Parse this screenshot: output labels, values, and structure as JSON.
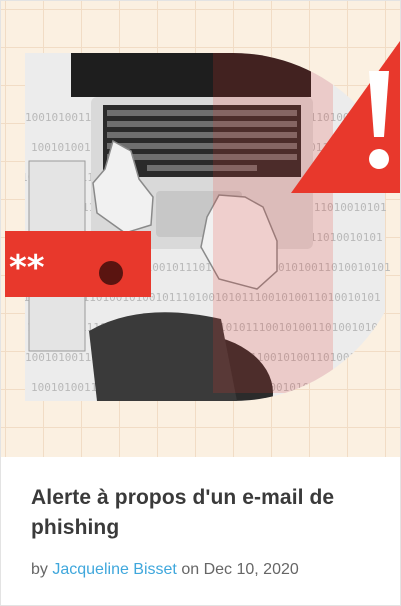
{
  "article": {
    "title": "Alerte à propos d'un e-mail de phishing",
    "byline_prefix": "by",
    "author": "Jacqueline Bisset",
    "date_prefix": "on",
    "date": "Dec 10, 2020"
  },
  "image": {
    "kind": "illustration",
    "binary_background": "100101001110100101001011101001010111001010011010010101",
    "password_mask": "**",
    "colors": {
      "background": "#fbf0e1",
      "grid": "#f1dcc5",
      "accent_red": "#e8382c",
      "dark_circle": "#2b2b2b"
    },
    "icons": [
      "warning-triangle-icon",
      "laptop-icon",
      "password-field-icon"
    ]
  }
}
